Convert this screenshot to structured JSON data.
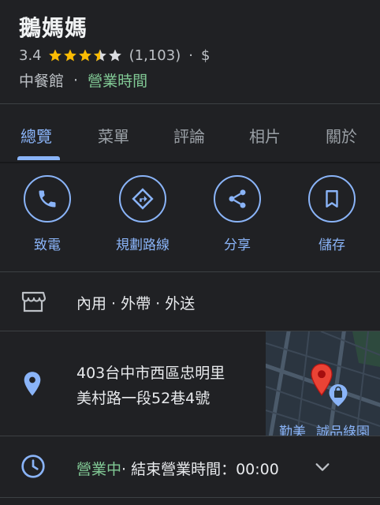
{
  "place": {
    "name": "鵝媽媽",
    "rating": "3.4",
    "stars_fraction": 0.68,
    "review_count": "(1,103)",
    "separator": "·",
    "price_level": "$",
    "category": "中餐館",
    "hours_link": "營業時間"
  },
  "tabs": [
    {
      "label": "總覽"
    },
    {
      "label": "菜單"
    },
    {
      "label": "評論"
    },
    {
      "label": "相片"
    },
    {
      "label": "關於"
    }
  ],
  "actions": [
    {
      "label": "致電",
      "icon": "phone-icon"
    },
    {
      "label": "規劃路線",
      "icon": "directions-icon"
    },
    {
      "label": "分享",
      "icon": "share-icon"
    },
    {
      "label": "儲存",
      "icon": "bookmark-icon"
    }
  ],
  "service_options": "內用 · 外帶 · 外送",
  "address": {
    "line1": "403台中市西區忠明里",
    "line2": "美村路一段52巷4號"
  },
  "map": {
    "labels": [
      "勤美",
      "誠品綠園"
    ]
  },
  "hours": {
    "status": "營業中",
    "detail": "· 結束營業時間：00:00"
  },
  "colors": {
    "accent": "#8ab4f8",
    "open_green": "#81c995",
    "star": "#fbbc04",
    "pin": "#ea4335"
  }
}
